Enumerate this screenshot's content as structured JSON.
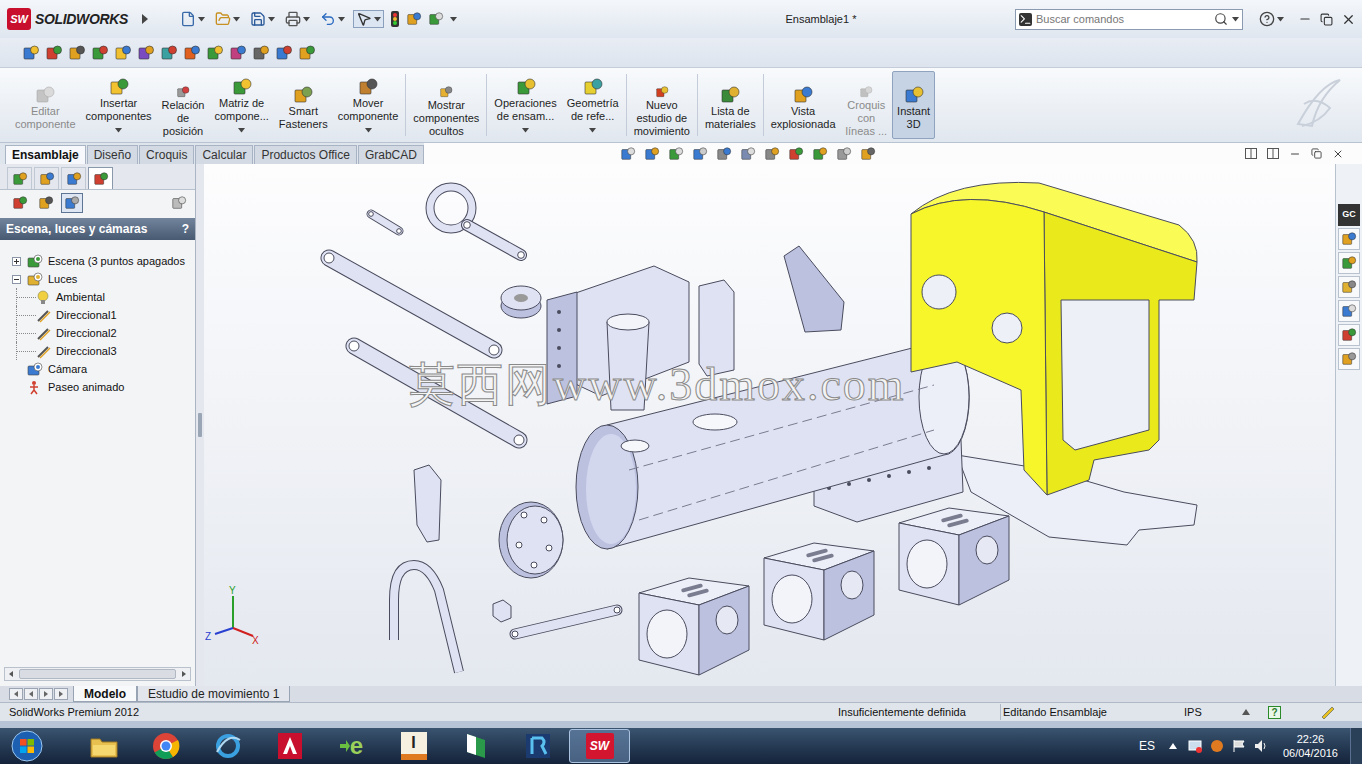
{
  "window": {
    "logo": "SW",
    "app": "SOLIDWORKS",
    "title": "Ensamblaje1 *"
  },
  "search": {
    "placeholder": "Buscar comandos"
  },
  "ribbon": [
    {
      "lines": [
        "Editar",
        "componente"
      ],
      "disabled": true,
      "selected": false,
      "dropdown": false
    },
    {
      "lines": [
        "Insertar",
        "componentes"
      ],
      "disabled": false,
      "selected": false,
      "dropdown": true
    },
    {
      "lines": [
        "Relación",
        "de",
        "posición"
      ],
      "disabled": false,
      "selected": false,
      "dropdown": false
    },
    {
      "lines": [
        "Matriz de",
        "compone..."
      ],
      "disabled": false,
      "selected": false,
      "dropdown": true
    },
    {
      "lines": [
        "Smart",
        "Fasteners"
      ],
      "disabled": false,
      "selected": false,
      "dropdown": false
    },
    {
      "lines": [
        "Mover",
        "componente"
      ],
      "disabled": false,
      "selected": false,
      "dropdown": true
    },
    {
      "lines": [
        "Mostrar",
        "componentes",
        "ocultos"
      ],
      "disabled": false,
      "selected": false,
      "dropdown": false
    },
    {
      "lines": [
        "Operaciones",
        "de ensam..."
      ],
      "disabled": false,
      "selected": false,
      "dropdown": true
    },
    {
      "lines": [
        "Geometría",
        "de refe..."
      ],
      "disabled": false,
      "selected": false,
      "dropdown": true
    },
    {
      "lines": [
        "Nuevo",
        "estudio de",
        "movimiento"
      ],
      "disabled": false,
      "selected": false,
      "dropdown": false
    },
    {
      "lines": [
        "Lista de",
        "materiales"
      ],
      "disabled": false,
      "selected": false,
      "dropdown": false
    },
    {
      "lines": [
        "Vista",
        "explosionada"
      ],
      "disabled": false,
      "selected": false,
      "dropdown": false
    },
    {
      "lines": [
        "Croquis",
        "con",
        "líneas ..."
      ],
      "disabled": true,
      "selected": false,
      "dropdown": false
    },
    {
      "lines": [
        "Instant",
        "3D"
      ],
      "disabled": false,
      "selected": true,
      "dropdown": false
    }
  ],
  "tabs": [
    {
      "label": "Ensamblaje",
      "selected": true
    },
    {
      "label": "Diseño",
      "selected": false
    },
    {
      "label": "Croquis",
      "selected": false
    },
    {
      "label": "Calcular",
      "selected": false
    },
    {
      "label": "Productos Office",
      "selected": false
    },
    {
      "label": "GrabCAD",
      "selected": false
    }
  ],
  "panel": {
    "title": "Escena, luces y cámaras",
    "help": "?",
    "manager_tabs": [
      {
        "selected": false
      },
      {
        "selected": false
      },
      {
        "selected": false
      },
      {
        "selected": true
      }
    ],
    "display_tabs": [
      {
        "selected": false
      },
      {
        "selected": false
      },
      {
        "selected": true
      }
    ],
    "tree": [
      {
        "label": "Escena (3 puntos apagados",
        "kind": "scene",
        "expandable": true,
        "expanded": false,
        "children": []
      },
      {
        "label": "Luces",
        "kind": "lights",
        "expandable": true,
        "expanded": true,
        "children": [
          {
            "label": "Ambiental",
            "kind": "ambient"
          },
          {
            "label": "Direccional1",
            "kind": "directional"
          },
          {
            "label": "Direccional2",
            "kind": "directional"
          },
          {
            "label": "Direccional3",
            "kind": "directional"
          }
        ]
      },
      {
        "label": "Cámara",
        "kind": "camera",
        "expandable": false,
        "expanded": false,
        "children": []
      },
      {
        "label": "Paseo animado",
        "kind": "walkthrough",
        "expandable": false,
        "expanded": false,
        "children": []
      }
    ]
  },
  "viewport": {
    "watermark": "莫西网www.3dmox.com",
    "axes": [
      "Y",
      "Z",
      "X"
    ]
  },
  "task_pane": {
    "badge": "GC"
  },
  "bottom_tabs": [
    {
      "label": "Modelo",
      "selected": true
    },
    {
      "label": "Estudio de movimiento 1",
      "selected": false
    }
  ],
  "status_bar": {
    "product": "SolidWorks Premium 2012",
    "definition": "Insuficientemente definida",
    "mode": "Editando Ensamblaje",
    "units": "IPS",
    "help": "?"
  },
  "taskbar": {
    "apps": [
      {
        "kind": "explorer",
        "label": "",
        "selected": false
      },
      {
        "kind": "chrome",
        "label": "",
        "selected": false
      },
      {
        "kind": "browser",
        "label": "",
        "selected": false
      },
      {
        "kind": "autocad",
        "label": "",
        "selected": false
      },
      {
        "kind": "edrawings",
        "label": "e",
        "selected": false
      },
      {
        "kind": "inventor",
        "label": "I",
        "selected": false
      },
      {
        "kind": "dwg",
        "label": "",
        "selected": false
      },
      {
        "kind": "revit",
        "label": "",
        "selected": false
      },
      {
        "kind": "solidworks",
        "label": "SW",
        "selected": true
      }
    ],
    "language": "ES",
    "time": "22:26",
    "date": "06/04/2016"
  }
}
